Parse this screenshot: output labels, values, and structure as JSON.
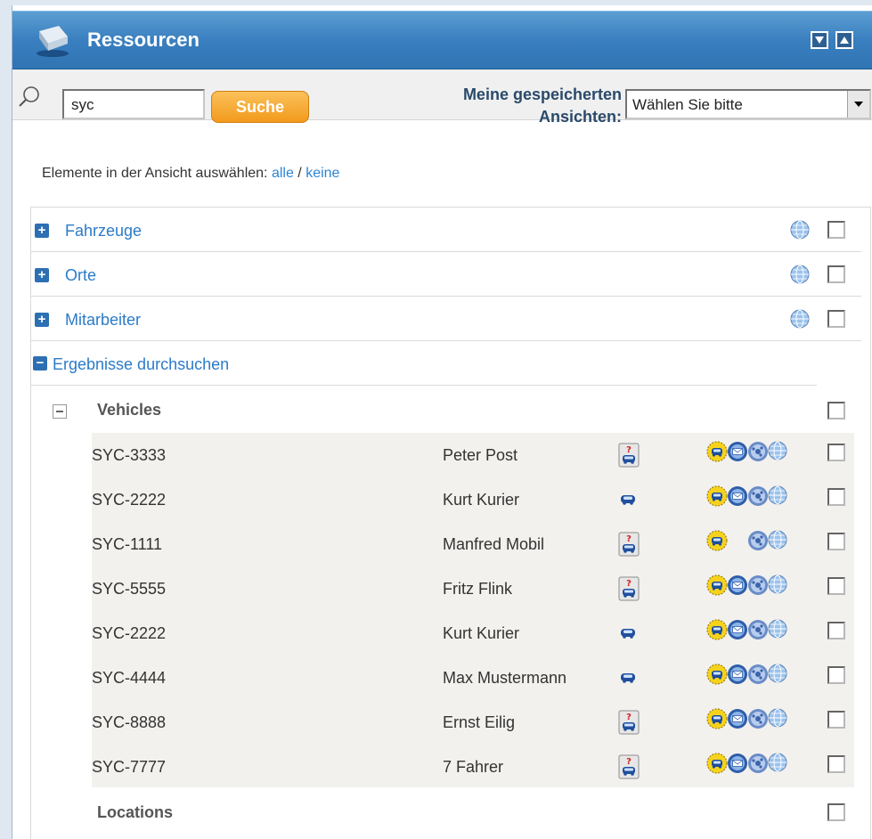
{
  "header": {
    "title": "Ressourcen"
  },
  "search": {
    "value": "syc",
    "button_label": "Suche",
    "views_label": "Meine gespeicherten Ansichten:",
    "views_selected": "Wählen Sie bitte"
  },
  "select_hint": {
    "text": "Elemente in der Ansicht auswählen:",
    "all": "alle",
    "sep": "/",
    "none": "keine"
  },
  "categories": [
    {
      "label": "Fahrzeuge"
    },
    {
      "label": "Orte"
    },
    {
      "label": "Mitarbeiter"
    }
  ],
  "results": {
    "label": "Ergebnisse durchsuchen",
    "groups": [
      {
        "label": "Vehicles"
      },
      {
        "label": "Locations"
      }
    ],
    "rows": [
      {
        "plate": "SYC-3333",
        "driver": "Peter Post",
        "unknown_vehicle": true,
        "has_message": true
      },
      {
        "plate": "SYC-2222",
        "driver": "Kurt Kurier",
        "unknown_vehicle": false,
        "has_message": true
      },
      {
        "plate": "SYC-1111",
        "driver": "Manfred Mobil",
        "unknown_vehicle": true,
        "has_message": false
      },
      {
        "plate": "SYC-5555",
        "driver": "Fritz Flink",
        "unknown_vehicle": true,
        "has_message": true
      },
      {
        "plate": "SYC-2222",
        "driver": "Kurt Kurier",
        "unknown_vehicle": false,
        "has_message": true
      },
      {
        "plate": "SYC-4444",
        "driver": "Max Mustermann",
        "unknown_vehicle": false,
        "has_message": true
      },
      {
        "plate": "SYC-8888",
        "driver": "Ernst Eilig",
        "unknown_vehicle": true,
        "has_message": true
      },
      {
        "plate": "SYC-7777",
        "driver": "7 Fahrer",
        "unknown_vehicle": true,
        "has_message": true
      }
    ]
  },
  "colors": {
    "header": "#3a7fbf",
    "link": "#2b86d6",
    "button": "#f29a1c",
    "results_bg": "#f2f1ee"
  }
}
